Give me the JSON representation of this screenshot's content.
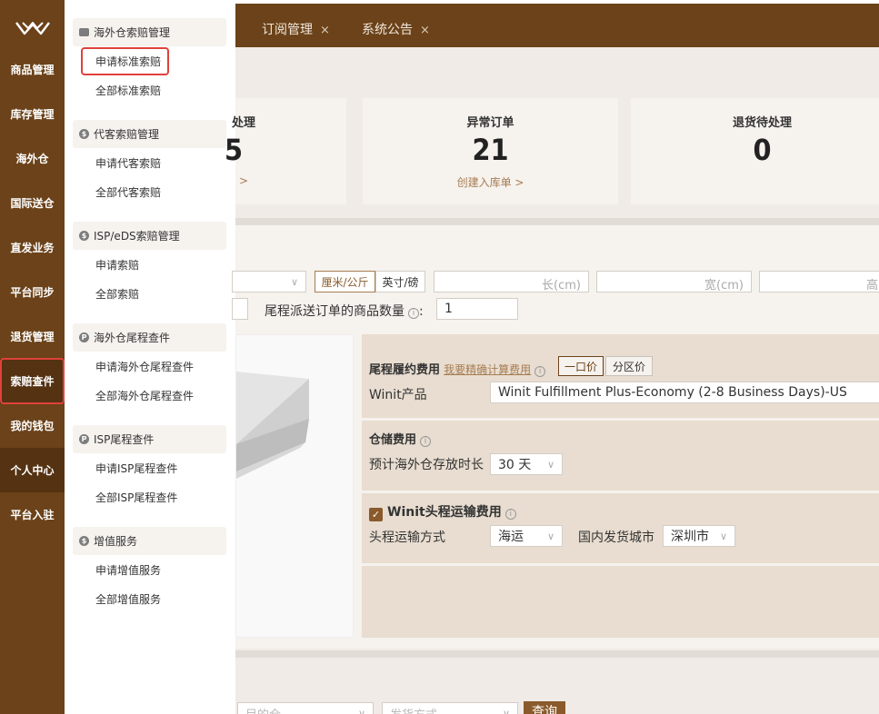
{
  "nav": {
    "items": [
      {
        "label": "商品管理"
      },
      {
        "label": "库存管理"
      },
      {
        "label": "海外仓"
      },
      {
        "label": "国际送仓"
      },
      {
        "label": "直发业务"
      },
      {
        "label": "平台同步"
      },
      {
        "label": "退货管理"
      },
      {
        "label": "索赔查件"
      },
      {
        "label": "我的钱包"
      },
      {
        "label": "个人中心"
      },
      {
        "label": "平台入驻"
      }
    ]
  },
  "submenu": {
    "groups": [
      {
        "title": "海外仓索赔管理",
        "icon": "card-icon",
        "links": [
          "申请标准索赔",
          "全部标准索赔"
        ]
      },
      {
        "title": "代客索赔管理",
        "icon": "dollar-icon",
        "links": [
          "申请代客索赔",
          "全部代客索赔"
        ]
      },
      {
        "title": "ISP/eDS索赔管理",
        "icon": "dollar-icon",
        "links": [
          "申请索赔",
          "全部索赔"
        ]
      },
      {
        "title": "海外仓尾程查件",
        "icon": "tag-icon",
        "links": [
          "申请海外仓尾程查件",
          "全部海外仓尾程查件"
        ]
      },
      {
        "title": "ISP尾程查件",
        "icon": "tag-icon",
        "links": [
          "申请ISP尾程查件",
          "全部ISP尾程查件"
        ]
      },
      {
        "title": "增值服务",
        "icon": "dollar-icon",
        "links": [
          "申请增值服务",
          "全部增值服务"
        ]
      }
    ]
  },
  "tabs": [
    {
      "label": "订阅管理",
      "close": "×"
    },
    {
      "label": "系统公告",
      "close": "×"
    }
  ],
  "stats": [
    {
      "title": "处理",
      "value": "5",
      "link": ">"
    },
    {
      "title": "异常订单",
      "value": "21",
      "link": "创建入库单 >"
    },
    {
      "title": "退货待处理",
      "value": "0",
      "link": ""
    }
  ],
  "form": {
    "unit_metric": "厘米/公斤",
    "unit_imperial": "英寸/磅",
    "length_placeholder": "长(cm)",
    "width_placeholder": "宽(cm)",
    "height_placeholder": "高",
    "qty_label": "尾程派送订单的商品数量",
    "qty_value": "1"
  },
  "fees": {
    "lastmile_title": "尾程履约费用",
    "precise_link": "我要精确计算费用",
    "flat_price": "一口价",
    "zone_price": "分区价",
    "winit_product_label": "Winit产品",
    "winit_product_value": "Winit Fulfillment Plus-Economy (2-8 Business Days)-US",
    "storage_title": "仓储费用",
    "storage_duration_label": "预计海外仓存放时长",
    "storage_duration_value": "30 天",
    "firstleg_title": "Winit头程运输费用",
    "firstleg_method_label": "头程运输方式",
    "firstleg_method_value": "海运",
    "origin_city_label": "国内发货城市",
    "origin_city_value": "深圳市"
  },
  "bottom": {
    "dest_placeholder": "目的仓",
    "ship_placeholder": "发货方式",
    "query_label": "查询"
  },
  "colors": {
    "nav_bg": "#6b4219",
    "accent": "#a67c52",
    "highlight": "#e0413b"
  }
}
